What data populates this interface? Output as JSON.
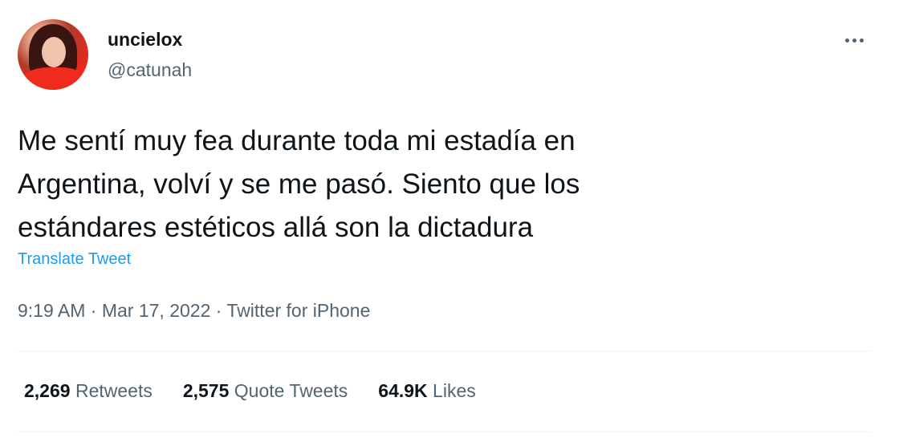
{
  "user": {
    "display_name": "uncielox",
    "handle": "@catunah"
  },
  "tweet": {
    "text": "Me sentí muy fea durante toda mi estadía en\nArgentina, volví y se me pasó. Siento que los\nestándares estéticos allá son la dictadura",
    "translate_label": "Translate Tweet",
    "time": "9:19 AM",
    "separator": "·",
    "date": "Mar 17, 2022",
    "source": "Twitter for iPhone"
  },
  "stats": {
    "retweets": {
      "count": "2,269",
      "label": "Retweets"
    },
    "quote_tweets": {
      "count": "2,575",
      "label": "Quote Tweets"
    },
    "likes": {
      "count": "64.9K",
      "label": "Likes"
    }
  },
  "icons": {
    "more": "more-icon"
  },
  "colors": {
    "text_primary": "#0f1419",
    "text_secondary": "#536471",
    "link": "#1d9bf0",
    "divider": "#eff3f4"
  }
}
